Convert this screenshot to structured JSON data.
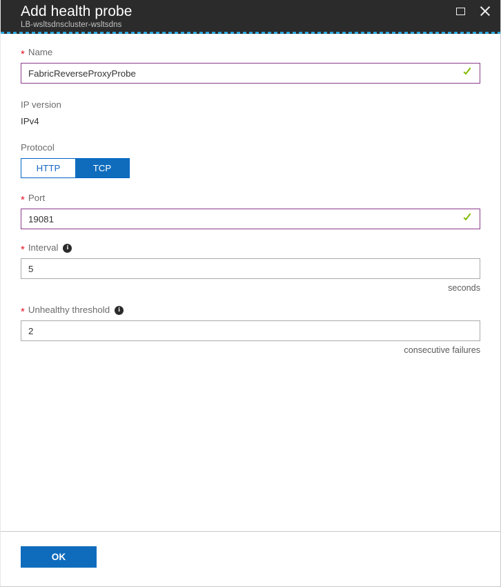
{
  "header": {
    "title": "Add health probe",
    "subtitle": "LB-wsltsdnscluster-wsltsdns",
    "restore_icon": "restore-icon",
    "close_icon": "close-icon"
  },
  "form": {
    "name": {
      "label": "Name",
      "required_marker": "*",
      "value": "FabricReverseProxyProbe",
      "placeholder": "",
      "validation_icon": "valid-check-icon"
    },
    "ip_version": {
      "label": "IP version",
      "value": "IPv4"
    },
    "protocol": {
      "label": "Protocol",
      "options": [
        "HTTP",
        "TCP"
      ],
      "selected": "TCP"
    },
    "port": {
      "label": "Port",
      "required_marker": "*",
      "value": "19081",
      "placeholder": "",
      "validation_icon": "valid-check-icon"
    },
    "interval": {
      "label": "Interval",
      "required_marker": "*",
      "value": "5",
      "placeholder": "",
      "info_icon": "info-icon",
      "suffix": "seconds"
    },
    "unhealthy_threshold": {
      "label": "Unhealthy threshold",
      "required_marker": "*",
      "value": "2",
      "placeholder": "",
      "info_icon": "info-icon",
      "suffix": "consecutive failures"
    }
  },
  "footer": {
    "ok_label": "OK"
  },
  "colors": {
    "accent": "#0f6cbd",
    "header_bg": "#2b2b2b",
    "valid_border": "#8a3a8a",
    "valid_check": "#7fba00",
    "required": "#e81123",
    "focus_dash": "#29a8e0"
  }
}
